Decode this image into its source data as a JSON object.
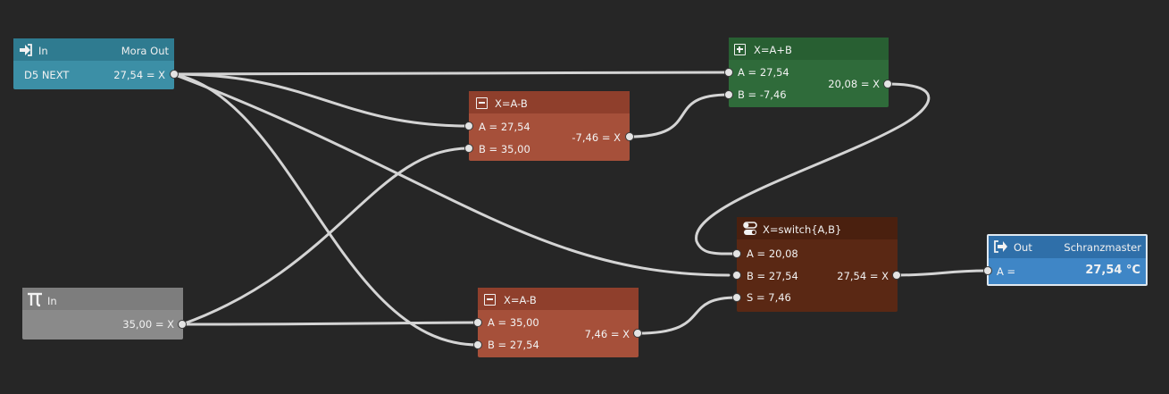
{
  "nodes": {
    "in_top": {
      "title": "In",
      "target": "Mora Out",
      "source": "D5 NEXT",
      "value": "27,54 = X",
      "color": "#3c8fa6",
      "icon": "sign-in-icon"
    },
    "sub1": {
      "title": "X=A-B",
      "a": "A = 27,54",
      "b": "B = 35,00",
      "result": "-7,46 = X",
      "color": "#a6503a",
      "icon": "minus-box-icon"
    },
    "add": {
      "title": "X=A+B",
      "a": "A = 27,54",
      "b": "B =  -7,46",
      "result": "20,08 = X",
      "color": "#2f6b3a",
      "icon": "plus-box-icon"
    },
    "const": {
      "title": "In",
      "value": "35,00 = X",
      "color": "#8a8a8a",
      "icon": "pi-icon"
    },
    "sub2": {
      "title": "X=A-B",
      "a": "A = 35,00",
      "b": "B = 27,54",
      "result": "7,46 = X",
      "color": "#a6503a",
      "icon": "minus-box-icon"
    },
    "switch": {
      "title": "X=switch{A,B}",
      "a": "A = 20,08",
      "b": "B =  27,54",
      "s": "S =  7,46",
      "result": "27,54 = X",
      "color": "#5a2814",
      "icon": "toggle-icon"
    },
    "out": {
      "title": "Out",
      "target": "Schranzmaster",
      "a": "A =",
      "value": "27,54 °C",
      "color": "#3f86c6",
      "icon": "sign-out-icon"
    }
  },
  "wire_color": "#d4d4d4",
  "background": "#262626"
}
